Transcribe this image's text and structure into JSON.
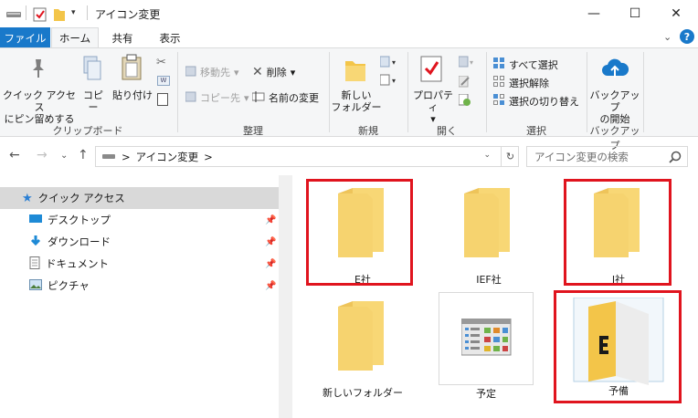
{
  "window": {
    "title": "アイコン変更",
    "minimize": "—",
    "maximize": "☐",
    "close": "✕"
  },
  "tabs": [
    {
      "label": "ファイル"
    },
    {
      "label": "ホーム"
    },
    {
      "label": "共有"
    },
    {
      "label": "表示"
    }
  ],
  "ribbon": {
    "clipboard": {
      "pin": "クイック アクセス\nにピン留めする",
      "pin_l1": "クイック アクセス",
      "pin_l2": "にピン留めする",
      "copy": "コピー",
      "paste": "貼り付け",
      "label": "クリップボード"
    },
    "organize": {
      "move": "移動先",
      "copy_to": "コピー先",
      "delete": "削除",
      "rename": "名前の変更",
      "label": "整理"
    },
    "new": {
      "new_folder_l1": "新しい",
      "new_folder_l2": "フォルダー",
      "label": "新規"
    },
    "open": {
      "properties": "プロパティ",
      "label": "開く"
    },
    "select": {
      "select_all": "すべて選択",
      "select_none": "選択解除",
      "invert": "選択の切り替え",
      "label": "選択"
    },
    "backup": {
      "start_l1": "バックアップ",
      "start_l2": "の開始",
      "label": "バックアップ"
    }
  },
  "address": {
    "path": "アイコン変更",
    "separator": ">",
    "search_placeholder": "アイコン変更の検索"
  },
  "navpane": {
    "items": [
      {
        "label": "クイック アクセス",
        "icon": "star-icon",
        "selected": true
      },
      {
        "label": "デスクトップ",
        "icon": "desktop-icon",
        "pinned": true
      },
      {
        "label": "ダウンロード",
        "icon": "download-icon",
        "pinned": true
      },
      {
        "label": "ドキュメント",
        "icon": "document-icon",
        "pinned": true
      },
      {
        "label": "ピクチャ",
        "icon": "picture-icon",
        "pinned": true
      }
    ]
  },
  "files": [
    {
      "name": "E社",
      "type": "folder",
      "highlighted": true
    },
    {
      "name": "IEF社",
      "type": "folder",
      "highlighted": false
    },
    {
      "name": "J社",
      "type": "folder",
      "highlighted": true
    },
    {
      "name": "新しいフォルダー",
      "type": "folder",
      "highlighted": false
    },
    {
      "name": "予定",
      "type": "folder-with-thumbnail",
      "highlighted": false
    },
    {
      "name": "予備",
      "type": "folder-open-custom",
      "highlighted": true
    }
  ],
  "colors": {
    "accent": "#1979ca",
    "highlight_box": "#e0141e",
    "folder": "#f8d775"
  }
}
